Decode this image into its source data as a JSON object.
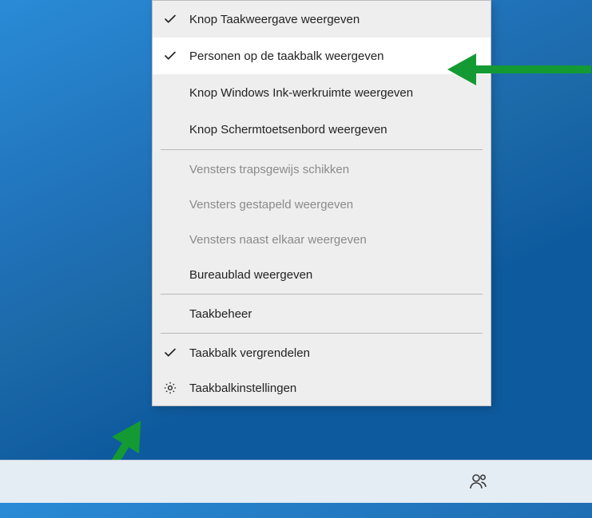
{
  "contextmenu": {
    "items": [
      {
        "label": "Knop Taakweergave weergeven",
        "checked": true,
        "disabled": false,
        "icon": "check",
        "highlight": false
      },
      {
        "label": "Personen op de taakbalk weergeven",
        "checked": true,
        "disabled": false,
        "icon": "check",
        "highlight": true
      },
      {
        "label": "Knop Windows Ink-werkruimte weergeven",
        "checked": false,
        "disabled": false,
        "icon": null,
        "highlight": false
      },
      {
        "label": "Knop Schermtoetsenbord weergeven",
        "checked": false,
        "disabled": false,
        "icon": null,
        "highlight": false
      },
      {
        "separator": true
      },
      {
        "label": "Vensters trapsgewijs schikken",
        "checked": false,
        "disabled": true,
        "icon": null,
        "highlight": false
      },
      {
        "label": "Vensters gestapeld weergeven",
        "checked": false,
        "disabled": true,
        "icon": null,
        "highlight": false
      },
      {
        "label": "Vensters naast elkaar weergeven",
        "checked": false,
        "disabled": true,
        "icon": null,
        "highlight": false
      },
      {
        "label": "Bureaublad weergeven",
        "checked": false,
        "disabled": false,
        "icon": null,
        "highlight": false
      },
      {
        "separator": true
      },
      {
        "label": "Taakbeheer",
        "checked": false,
        "disabled": false,
        "icon": null,
        "highlight": false
      },
      {
        "separator": true
      },
      {
        "label": "Taakbalk vergrendelen",
        "checked": true,
        "disabled": false,
        "icon": "check",
        "highlight": false
      },
      {
        "label": "Taakbalkinstellingen",
        "checked": false,
        "disabled": false,
        "icon": "gear",
        "highlight": false
      }
    ]
  },
  "annotations": {
    "arrow_right_target": "Personen op de taakbalk weergeven",
    "arrow_bottom_left_target": "taskbar-context-menu-origin"
  },
  "taskbar": {
    "people_button": "People"
  }
}
